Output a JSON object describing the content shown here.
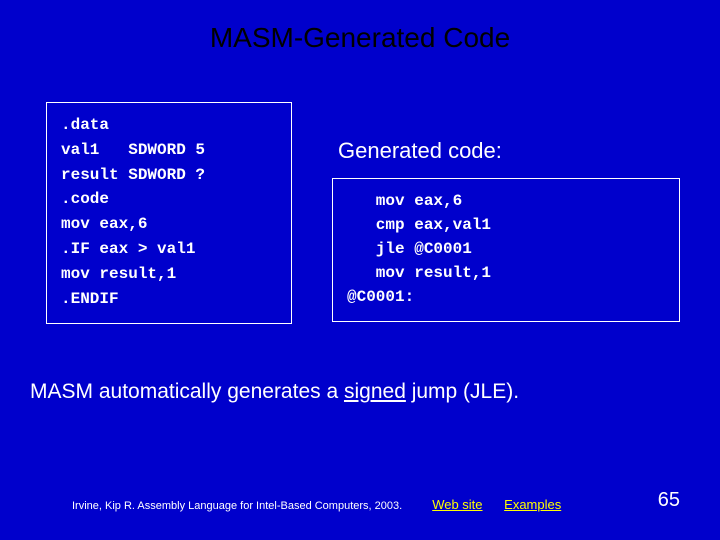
{
  "title": "MASM-Generated Code",
  "source_code": ".data\nval1   SDWORD 5\nresult SDWORD ?\n.code\nmov eax,6\n.IF eax > val1\nmov result,1\n.ENDIF",
  "generated_label": "Generated code:",
  "generated_code": "   mov eax,6\n   cmp eax,val1\n   jle @C0001\n   mov result,1\n@C0001:",
  "explanation_pre": "MASM automatically generates a ",
  "explanation_underlined": "signed",
  "explanation_post": " jump (JLE).",
  "citation": "Irvine, Kip R. Assembly Language for Intel-Based Computers, 2003.",
  "link_web": "Web site",
  "link_examples": "Examples",
  "page_number": "65"
}
